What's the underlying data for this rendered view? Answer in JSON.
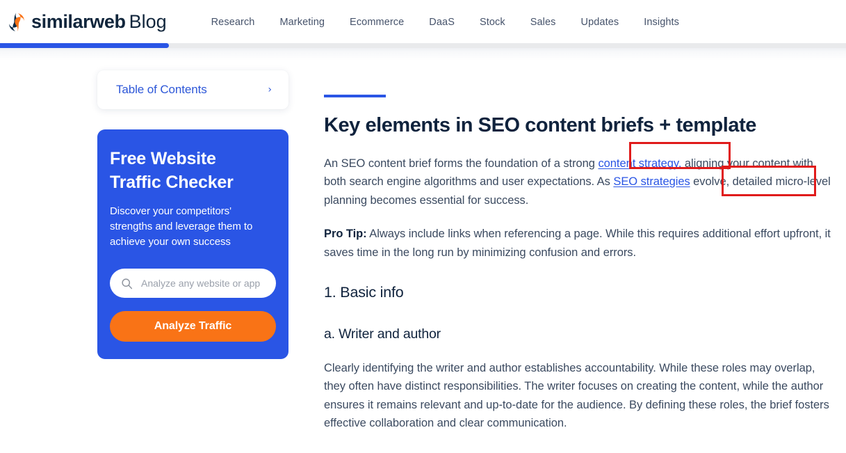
{
  "header": {
    "brand_name": "similarweb",
    "brand_suffix": "Blog",
    "logo_icon": "similarweb-swirl-icon",
    "nav_items": [
      {
        "label": "Research"
      },
      {
        "label": "Marketing"
      },
      {
        "label": "Ecommerce"
      },
      {
        "label": "DaaS"
      },
      {
        "label": "Stock"
      },
      {
        "label": "Sales"
      },
      {
        "label": "Updates"
      },
      {
        "label": "Insights"
      }
    ]
  },
  "progress": {
    "percent": 20,
    "fill_color": "#2a55e5",
    "track_color": "#e9eaec"
  },
  "sidebar": {
    "toc": {
      "label": "Table of Contents",
      "chevron_icon": "chevron-right-icon",
      "accent_color": "#2d57d8"
    },
    "cta": {
      "title_line1": "Free Website",
      "title_line2": "Traffic Checker",
      "subtitle": "Discover your competitors' strengths and leverage them to achieve your own success",
      "search_icon": "search-icon",
      "search_placeholder": "Analyze any website or app",
      "search_value": "",
      "button_label": "Analyze Traffic",
      "card_color": "#2a55e5",
      "button_color": "#f97316"
    }
  },
  "article": {
    "heading": "Key elements in SEO content briefs + template",
    "intro": {
      "before_link1": "An SEO content brief forms the foundation of a strong ",
      "link1": "content strategy,",
      "between_links": " aligning your content with both search engine algorithms and user expectations. As ",
      "link2": "SEO strategies",
      "after_link2": " evolve, detailed micro-level planning becomes essential for success."
    },
    "pro_tip": {
      "label": "Pro Tip:",
      "text": " Always include links when referencing a page. While this requires additional effort upfront, it saves time in the long run by minimizing confusion and errors."
    },
    "section_heading": "1. Basic info",
    "subsection_heading": "a. Writer and author",
    "body": "Clearly identifying the writer and author establishes accountability. While these roles may overlap, they often have distinct responsibilities. The writer focuses on creating the content, while the author ensures it remains relevant and up-to-date for the audience. By defining these roles, the brief fosters effective collaboration and clear communication."
  },
  "annotations": {
    "box_color": "#e01b1b",
    "boxes": [
      {
        "target": "content strategy,"
      },
      {
        "target": "SEO strategies"
      }
    ]
  }
}
